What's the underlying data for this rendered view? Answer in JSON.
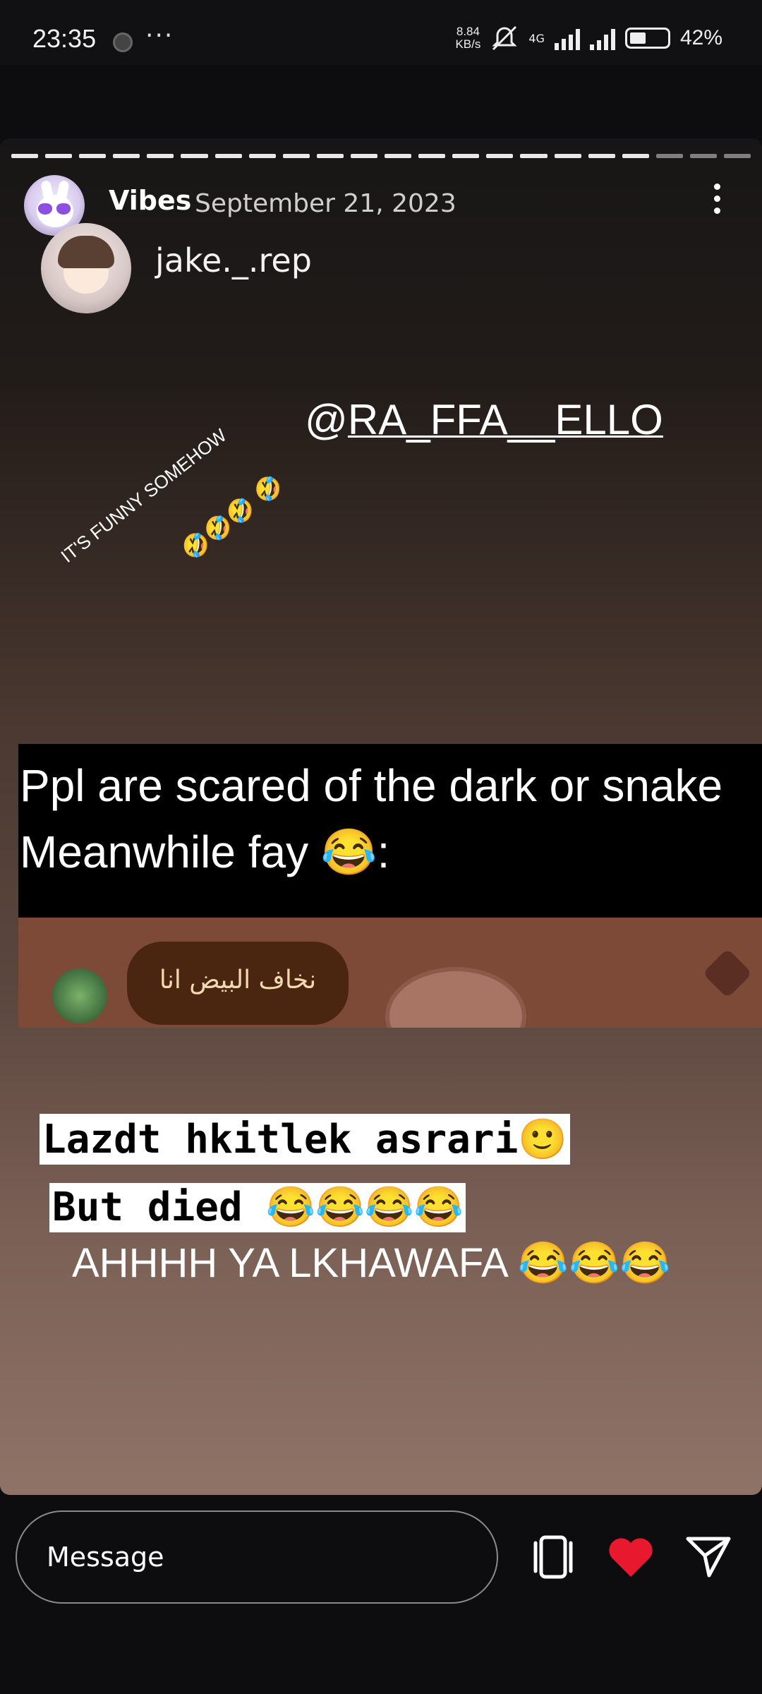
{
  "status_bar": {
    "time": "23:35",
    "more": "···",
    "speed_value": "8.84",
    "speed_unit": "KB/s",
    "network": "4G",
    "battery": "42%"
  },
  "story": {
    "author": "Vibes",
    "date": "September 21, 2023",
    "reposted_user": "jake._.rep",
    "mention_at": "@",
    "mention_handle": "RA_FFA__ELLO",
    "sticker_text": "IT'S FUNNY SOMEHOW",
    "sticker_emoji": "🤣🤣🤣 🤣",
    "screenshot": {
      "line1": "Ppl are scared of the dark or snake",
      "line2": "Meanwhile fay 😂:",
      "chat_message": "نخاف البيض انا",
      "highlight1": "Lazdt hkitlek asrari🙂",
      "highlight2": "But died 😂😂😂😂",
      "caption": "AHHHH YA LKHAWAFA 😂😂😂"
    }
  },
  "reply": {
    "placeholder": "Message"
  },
  "colors": {
    "like": "#e8182f",
    "background": "#0d0d10"
  }
}
